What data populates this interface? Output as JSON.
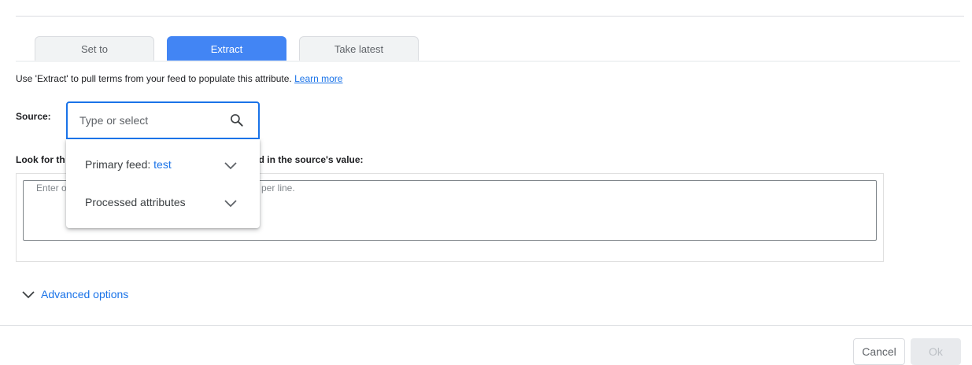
{
  "tabs": [
    {
      "label": "Set to",
      "active": false
    },
    {
      "label": "Extract",
      "active": true
    },
    {
      "label": "Take latest",
      "active": false
    }
  ],
  "description": {
    "text": "Use 'Extract' to pull terms from your feed to populate this attribute.",
    "link": "Learn more"
  },
  "source": {
    "label": "Source:",
    "placeholder": "Type or select",
    "icon": "search-icon"
  },
  "dropdown": {
    "items": [
      {
        "label": "Primary feed:",
        "value": "test",
        "icon": "chevron-down-icon"
      },
      {
        "label": "Processed attributes",
        "icon": "chevron-down-icon"
      }
    ]
  },
  "lookfor": {
    "label_start": "Look for th",
    "label_end": "found in the source's value:",
    "placeholder_start": "Enter o",
    "placeholder_end": "per line."
  },
  "advanced": {
    "label": "Advanced options",
    "icon": "chevron-down-icon"
  },
  "footer": {
    "cancel": "Cancel",
    "ok": "Ok"
  },
  "colors": {
    "accent": "#1a73e8",
    "tab_active": "#4285f4"
  }
}
